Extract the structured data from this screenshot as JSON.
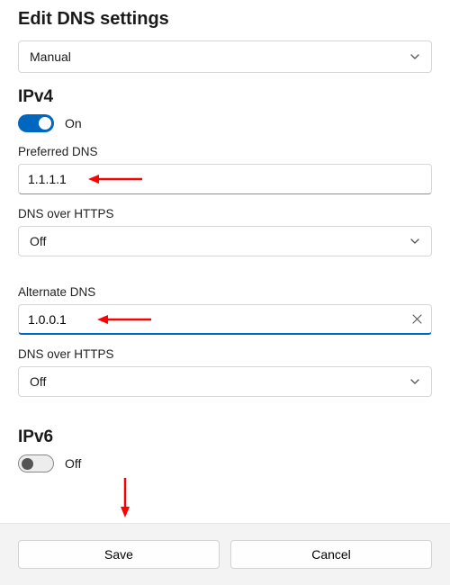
{
  "title": "Edit DNS settings",
  "mode_select": {
    "value": "Manual"
  },
  "ipv4": {
    "heading": "IPv4",
    "toggle_label": "On",
    "preferred_label": "Preferred DNS",
    "preferred_value": "1.1.1.1",
    "doh1_label": "DNS over HTTPS",
    "doh1_value": "Off",
    "alternate_label": "Alternate DNS",
    "alternate_value": "1.0.0.1",
    "doh2_label": "DNS over HTTPS",
    "doh2_value": "Off"
  },
  "ipv6": {
    "heading": "IPv6",
    "toggle_label": "Off"
  },
  "footer": {
    "save": "Save",
    "cancel": "Cancel"
  },
  "colors": {
    "accent": "#0067c0",
    "annotation": "#ff0000"
  }
}
